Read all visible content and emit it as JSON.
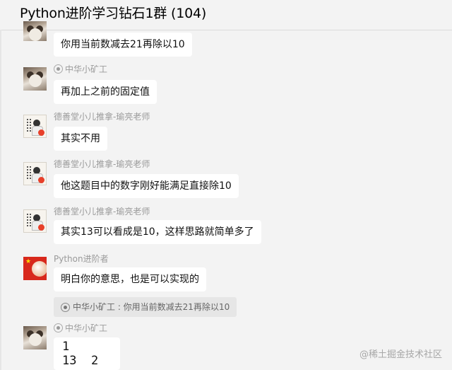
{
  "window": {
    "title": "Python进阶学习钻石1群 (104)"
  },
  "messages": [
    {
      "sender": "",
      "text": "你用当前数减去21再除以10",
      "avatar": "cat-avatar"
    },
    {
      "sender": "中华小矿工",
      "text": "再加上之前的固定值",
      "avatar": "cat-avatar"
    },
    {
      "sender": "德善堂小儿推拿-瑜亮老师",
      "text": "其实不用",
      "avatar": "doc-avatar"
    },
    {
      "sender": "德善堂小儿推拿-瑜亮老师",
      "text": "他这题目中的数字刚好能满足直接除10",
      "avatar": "doc-avatar"
    },
    {
      "sender": "德善堂小儿推拿-瑜亮老师",
      "text": "其实13可以看成是10，这样思路就简单多了",
      "avatar": "doc-avatar"
    },
    {
      "sender": "Python进阶者",
      "text": "明白你的意思，也是可以实现的",
      "avatar": "flag-avatar"
    },
    {
      "sender": "中华小矿工",
      "text": "",
      "avatar": "cat-avatar"
    }
  ],
  "quote": {
    "text": "中华小矿工 : 你用当前数减去21再除以10"
  },
  "code_lines": [
    "1",
    "13  2"
  ],
  "watermark": {
    "text": "@稀土掘金技术社区"
  }
}
